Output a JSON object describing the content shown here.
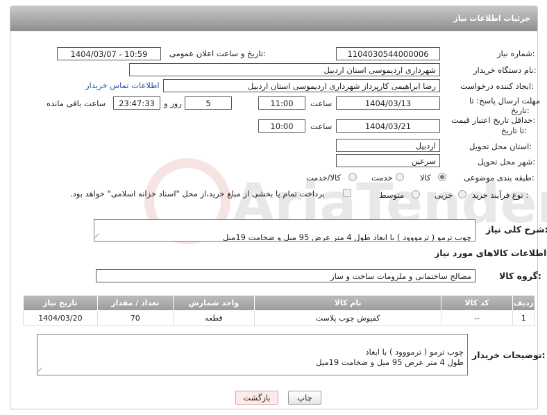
{
  "header": {
    "title": "جزئیات اطلاعات نیاز"
  },
  "form": {
    "need_number_label": "شماره نیاز:",
    "need_number": "1104030544000006",
    "announce_label": "تاریخ و ساعت اعلان عمومی:",
    "announce_value": "1404/03/07 - 10:59",
    "buyer_org_label": "نام دستگاه خریدار:",
    "buyer_org": "شهرداری اردیموسی استان اردبیل",
    "creator_label": "ایجاد کننده درخواست:",
    "creator": "رضا ابراهیمی کارپرداز شهرداری اردیموسی استان اردبیل",
    "contact_link": "اطلاعات تماس خریدار",
    "reply_deadline_label_1": "مهلت ارسال پاسخ: تا",
    "reply_deadline_label_2": "تاریخ:",
    "reply_date": "1404/03/13",
    "hour_label": "ساعت",
    "reply_time": "11:00",
    "days_value": "5",
    "days_label": "روز و",
    "remaining_time": "23:47:33",
    "remaining_label": "ساعت باقی مانده",
    "price_valid_label_1": "حداقل تاریخ اعتبار قیمت:",
    "price_valid_label_2": "تا تاریخ:",
    "price_date": "1404/03/21",
    "price_time": "10:00",
    "province_label": "استان محل تحویل:",
    "province": "اردبیل",
    "city_label": "شهر محل تحویل:",
    "city": "سرعین",
    "category_label": "طبقه بندی موضوعی:",
    "category_options": [
      "کالا",
      "خدمت",
      "کالا/خدمت"
    ],
    "process_label": "نوع فرآیند خرید :",
    "process_options": [
      "جزیی",
      "متوسط"
    ],
    "payment_note": "پرداخت تمام یا بخشی از مبلغ خرید،از محل \"اسناد خزانه اسلامی\" خواهد بود.",
    "description_label": "شرح کلی نیاز:",
    "description": "چوب ترمو ( ترمووود ) با ابعاد      طول 4 متر عرض 95 میل و ضخامت 19میل"
  },
  "goods": {
    "section_title": "اطلاعات کالاهای مورد نیاز",
    "group_label": "گروه کالا:",
    "group_value": "مصالح ساختمانی و ملزومات ساخت و ساز",
    "columns": [
      "ردیف",
      "کد کالا",
      "نام کالا",
      "واحد شمارش",
      "تعداد / مقدار",
      "تاریخ نیاز"
    ],
    "rows": [
      {
        "row": "1",
        "code": "--",
        "name": "کفپوش چوب پلاست",
        "unit": "قطعه",
        "qty": "70",
        "date": "1404/03/20"
      }
    ]
  },
  "buyer_notes": {
    "label": "توضیحات خریدار:",
    "text": "چوب ترمو ( ترمووود )  با ابعاد\nطول 4 متر عرض 95 میل و ضخامت 19میل"
  },
  "buttons": {
    "print": "چاپ",
    "back": "بازگشت"
  },
  "watermark_text": "AriaTender.neT"
}
